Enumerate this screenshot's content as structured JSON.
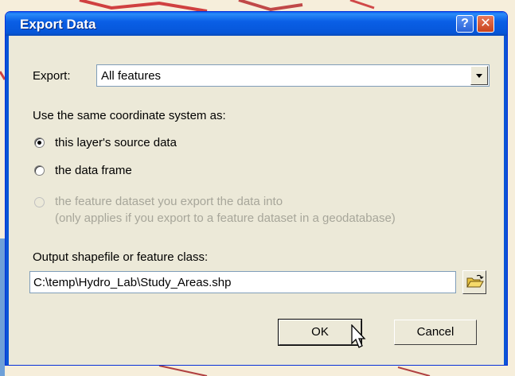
{
  "window": {
    "title": "Export Data",
    "help_glyph": "?",
    "close_glyph": "✕"
  },
  "export": {
    "label": "Export:",
    "selected": "All features"
  },
  "coordinate": {
    "heading": "Use the same coordinate system as:",
    "options": [
      {
        "label": "this layer's source data",
        "checked": true,
        "enabled": true
      },
      {
        "label": "the data frame",
        "checked": false,
        "enabled": true
      },
      {
        "label": "the feature dataset you export the data into",
        "sublabel": "(only applies if you export to a feature dataset in a geodatabase)",
        "checked": false,
        "enabled": false
      }
    ]
  },
  "output": {
    "label": "Output shapefile or feature class:",
    "value": "C:\\temp\\Hydro_Lab\\Study_Areas.shp"
  },
  "buttons": {
    "ok": "OK",
    "cancel": "Cancel"
  },
  "icons": {
    "browse": "folder-open-icon",
    "cursor": "mouse-pointer-icon"
  }
}
